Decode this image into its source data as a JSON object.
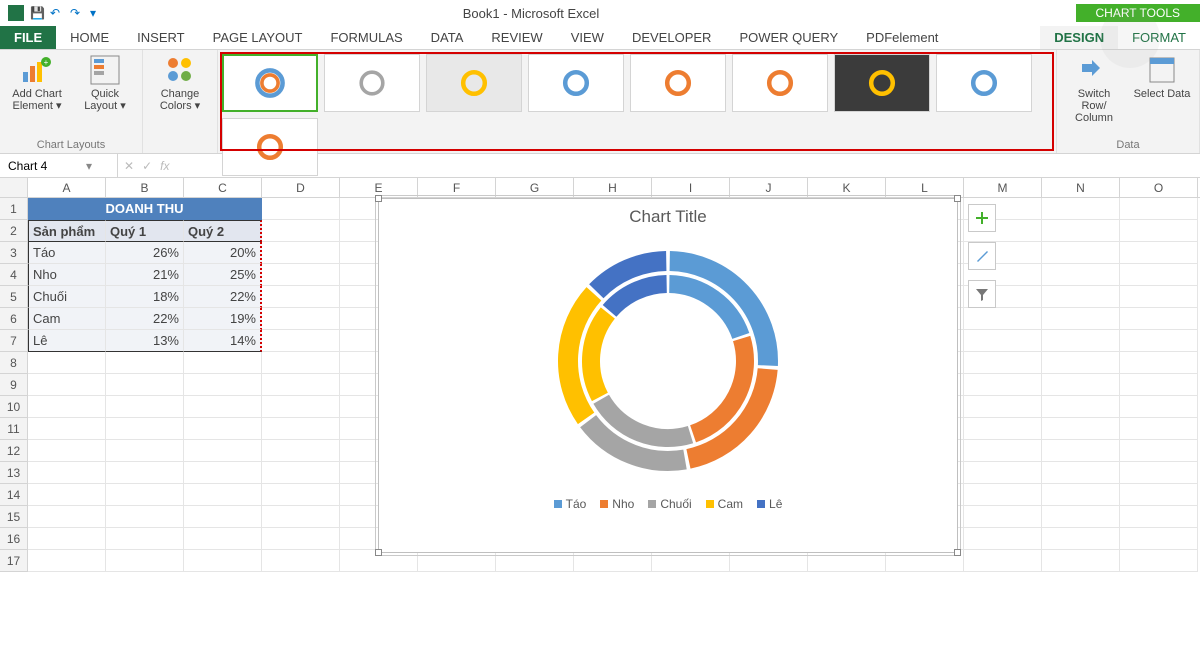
{
  "app": {
    "title": "Book1 - Microsoft Excel",
    "chart_tools": "CHART TOOLS"
  },
  "tabs": {
    "file": "FILE",
    "home": "HOME",
    "insert": "INSERT",
    "page_layout": "PAGE LAYOUT",
    "formulas": "FORMULAS",
    "data": "DATA",
    "review": "REVIEW",
    "view": "VIEW",
    "developer": "DEVELOPER",
    "power_query": "POWER QUERY",
    "pdfelement": "PDFelement",
    "design": "DESIGN",
    "format": "FORMAT"
  },
  "ribbon": {
    "add_chart_element": "Add Chart Element ▾",
    "quick_layout": "Quick Layout ▾",
    "chart_layouts": "Chart Layouts",
    "change_colors": "Change Colors ▾",
    "switch_row_col": "Switch Row/ Column",
    "select_data": "Select Data",
    "data_group": "Data"
  },
  "namebox": "Chart 4",
  "columns": [
    "A",
    "B",
    "C",
    "D",
    "E",
    "F",
    "G",
    "H",
    "I",
    "J",
    "K",
    "L",
    "M",
    "N",
    "O"
  ],
  "table": {
    "title": "DOANH THU",
    "headers": [
      "Sản phẩm",
      "Quý 1",
      "Quý 2"
    ],
    "rows": [
      {
        "p": "Táo",
        "q1": "26%",
        "q2": "20%"
      },
      {
        "p": "Nho",
        "q1": "21%",
        "q2": "25%"
      },
      {
        "p": "Chuối",
        "q1": "18%",
        "q2": "22%"
      },
      {
        "p": "Cam",
        "q1": "22%",
        "q2": "19%"
      },
      {
        "p": "Lê",
        "q1": "13%",
        "q2": "14%"
      }
    ]
  },
  "chart": {
    "title": "Chart Title",
    "legend": [
      "Táo",
      "Nho",
      "Chuối",
      "Cam",
      "Lê"
    ],
    "colors": [
      "#5b9bd5",
      "#ed7d31",
      "#a5a5a5",
      "#ffc000",
      "#4472c4"
    ]
  },
  "chart_data": {
    "type": "pie",
    "subtype": "doughnut-multiseries",
    "title": "Chart Title",
    "categories": [
      "Táo",
      "Nho",
      "Chuối",
      "Cam",
      "Lê"
    ],
    "series": [
      {
        "name": "Quý 1",
        "values": [
          26,
          21,
          18,
          22,
          13
        ]
      },
      {
        "name": "Quý 2",
        "values": [
          20,
          25,
          22,
          19,
          14
        ]
      }
    ],
    "colors": [
      "#5b9bd5",
      "#ed7d31",
      "#a5a5a5",
      "#ffc000",
      "#4472c4"
    ],
    "value_format": "percent"
  },
  "side_buttons": {
    "plus": "+",
    "brush": "🖌",
    "funnel": "▾"
  }
}
